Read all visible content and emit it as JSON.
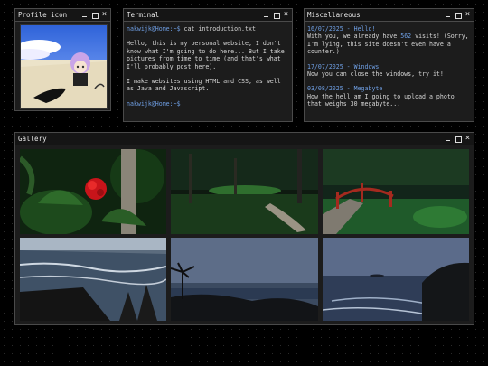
{
  "windows": {
    "profile": {
      "title": "Profile icon"
    },
    "terminal": {
      "title": "Terminal",
      "prompt": "nakwijk@Home:~$",
      "command": " cat introduction.txt",
      "para1": "Hello, this is my personal website, I don't know what I'm going to do here... But I take pictures from time to time (and that's what I'll probably post here).",
      "para2": "I make websites using HTML and CSS, as well as Java and Javascript.",
      "prompt2": "nakwijk@Home:~$"
    },
    "misc": {
      "title": "Miscellaneous",
      "entries": [
        {
          "date_label": "16/07/2025 - Hello!",
          "text_before": "With you, we already have ",
          "count": "562",
          "text_after": " visits! (Sorry, I'm lying, this site doesn't even have a counter.)"
        },
        {
          "date_label": "17/07/2025 - Windows",
          "text": "Now you can close the windows, try it!"
        },
        {
          "date_label": "03/08/2025 - Megabyte",
          "text": "How the hell am I going to upload a photo that weighs 30 megabyte..."
        }
      ]
    },
    "gallery": {
      "title": "Gallery"
    }
  },
  "icons": {
    "minimize": "minimize-icon",
    "maximize": "maximize-icon",
    "close": "close-icon"
  },
  "colors": {
    "accent": "#6f9fe4",
    "window_bg": "#1c1c1c",
    "border": "#4a4a4a"
  }
}
